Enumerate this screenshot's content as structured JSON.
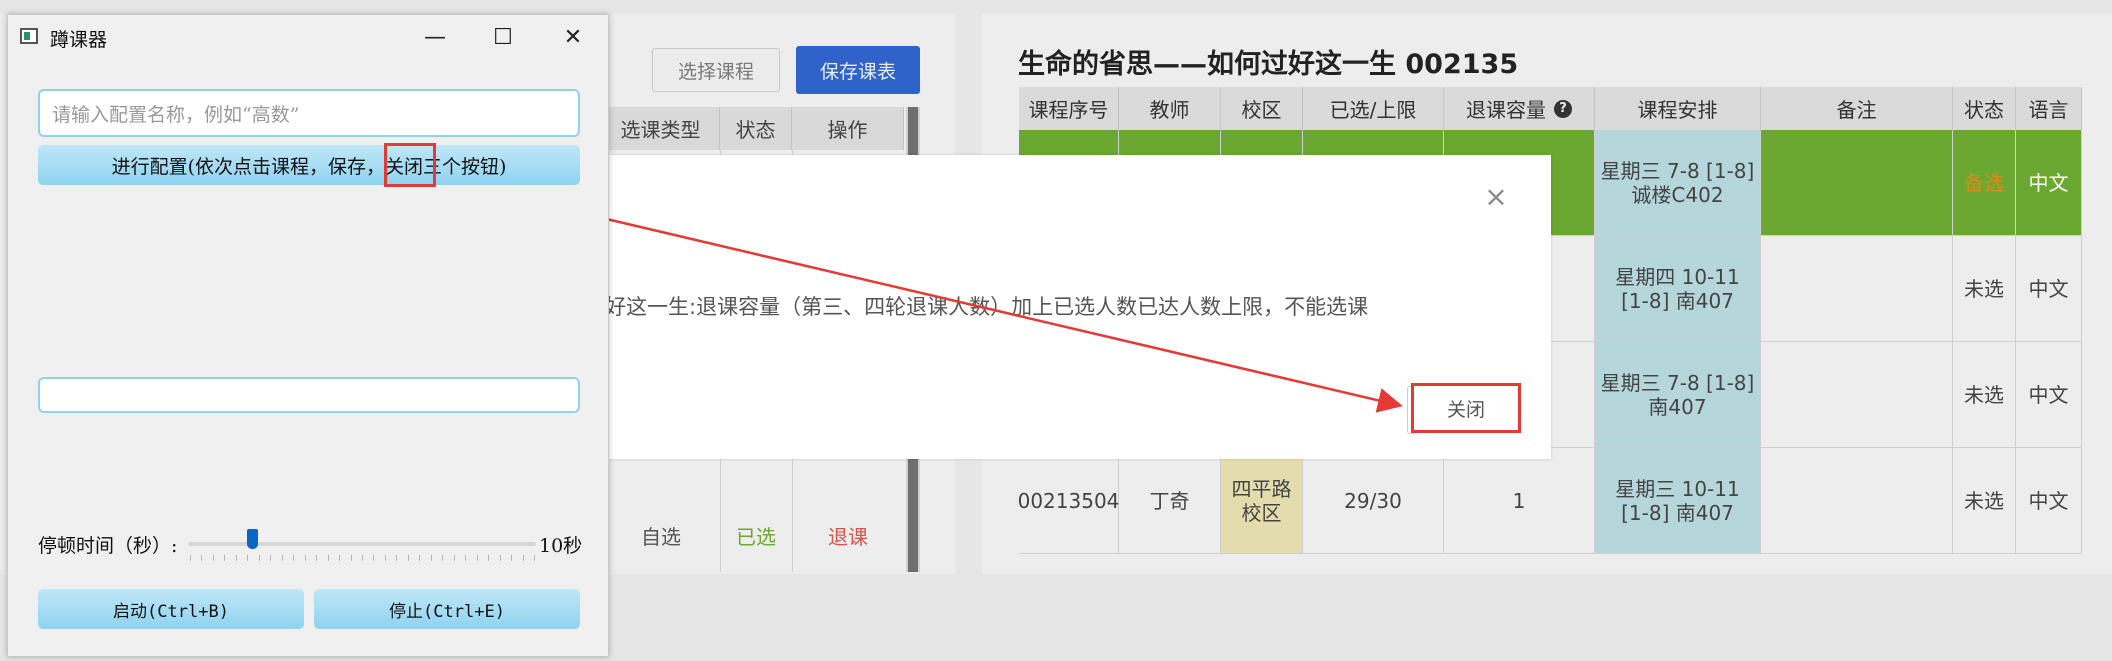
{
  "background_left": {
    "select_course_label": "选择课程",
    "save_schedule_label": "保存课表",
    "columns": [
      "选课类型",
      "状态",
      "操作"
    ],
    "row": {
      "type": "自选",
      "status": "已选",
      "action": "退课"
    }
  },
  "course": {
    "title": "生命的省思——如何过好这一生 002135",
    "columns": [
      "课程序号",
      "教师",
      "校区",
      "已选/上限",
      "退课容量",
      "课程安排",
      "备注",
      "状态",
      "语言"
    ],
    "rows": [
      {
        "id": "",
        "teacher": "",
        "campus": "",
        "count": "",
        "capacity": "",
        "schedule": "星期三 7-8 [1-8] 诚楼C402",
        "note": "",
        "status": "备选",
        "lang": "中文"
      },
      {
        "id": "",
        "teacher": "",
        "campus": "",
        "count": "",
        "capacity": "",
        "schedule": "星期四 10-11 [1-8] 南407",
        "note": "",
        "status": "未选",
        "lang": "中文"
      },
      {
        "id": "",
        "teacher": "",
        "campus": "",
        "count": "",
        "capacity": "",
        "schedule": "星期三 7-8 [1-8] 南407",
        "note": "",
        "status": "未选",
        "lang": "中文"
      },
      {
        "id": "00213504",
        "teacher": "丁奇",
        "campus": "四平路校区",
        "count": "29/30",
        "capacity": "1",
        "schedule": "星期三 10-11 [1-8] 南407",
        "note": "",
        "status": "未选",
        "lang": "中文"
      }
    ]
  },
  "dialog": {
    "message": "好这一生:退课容量（第三、四轮退课人数）加上已选人数已达人数上限，不能选课",
    "close_label": "关闭",
    "close_icon": "×"
  },
  "app": {
    "title": "蹲课器",
    "minimize_glyph": "—",
    "maximize_glyph": "☐",
    "close_glyph": "✕",
    "config_placeholder": "请输入配置名称，例如“高数”",
    "config_button": "进行配置(依次点击课程，保存，关闭三个按钮)",
    "pause_label": "停顿时间（秒）:",
    "pause_value": "10秒",
    "pause_level": 0.18,
    "start_label": "启动(Ctrl+B)",
    "stop_label": "停止(Ctrl+E)"
  },
  "colors": {
    "accent_blue": "#2f63c9",
    "selected_row_green": "#6aa832",
    "annotation_red": "#e53935",
    "status_selected": "#6aaa2a",
    "status_drop": "#d9534f",
    "status_backup": "#e08a1c"
  }
}
